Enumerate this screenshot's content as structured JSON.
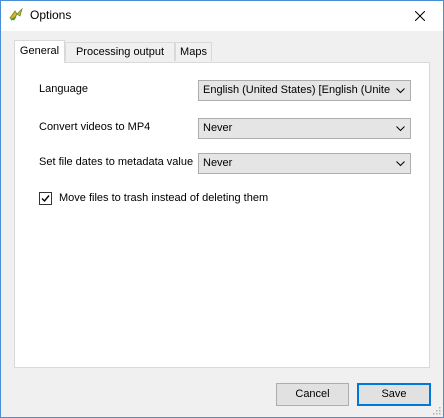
{
  "window": {
    "title": "Options"
  },
  "tabs": [
    {
      "label": "General",
      "active": true
    },
    {
      "label": "Processing output",
      "active": false
    },
    {
      "label": "Maps",
      "active": false
    }
  ],
  "general": {
    "language": {
      "label": "Language",
      "value": "English (United States) [English (United States)]"
    },
    "convert_videos": {
      "label": "Convert videos to MP4",
      "value": "Never"
    },
    "file_dates": {
      "label": "Set file dates to metadata value",
      "value": "Never"
    },
    "trash_checkbox": {
      "label": "Move files to trash instead of deleting them",
      "checked": true
    }
  },
  "footer": {
    "cancel_label": "Cancel",
    "save_label": "Save"
  },
  "colors": {
    "window_border": "#4a8fd6",
    "dialog_bg": "#f0f0f0",
    "default_button_border": "#0078d7"
  },
  "icons": {
    "app": "app-logo-icon",
    "close": "close-icon",
    "dropdown": "chevron-down-icon",
    "check": "checkmark-icon"
  }
}
